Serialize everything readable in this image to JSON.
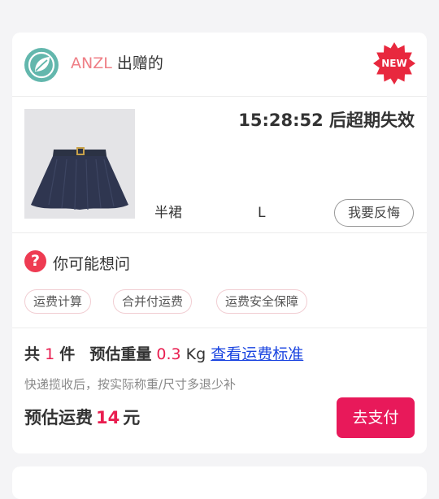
{
  "header": {
    "nickname": "ANZL",
    "action_text": "出赠的",
    "badge": "NEW",
    "avatar_icon": "leaf-icon"
  },
  "product": {
    "expire_text": "15:28:52 后超期失效",
    "name": "半裙",
    "size": "L",
    "regret_button": "我要反悔"
  },
  "faq": {
    "title": "你可能想问",
    "chips": [
      "运费计算",
      "合并付运费",
      "运费安全保障"
    ]
  },
  "summary": {
    "count_prefix": "共",
    "count": "1",
    "count_suffix": "件",
    "weight_label": "预估重量",
    "weight_value": "0.3",
    "weight_unit": "Kg",
    "fee_link": "查看运费标准",
    "note": "快递揽收后，按实际称重/尺寸多退少补",
    "fee_label": "预估运费",
    "fee_value": "14",
    "fee_unit": "元",
    "pay_button": "去支付"
  },
  "colors": {
    "accent": "#e8195a",
    "badge": "#e8283e",
    "nickname": "#ef7f86",
    "link": "#1a44e0",
    "avatar": "#63b7ad"
  }
}
